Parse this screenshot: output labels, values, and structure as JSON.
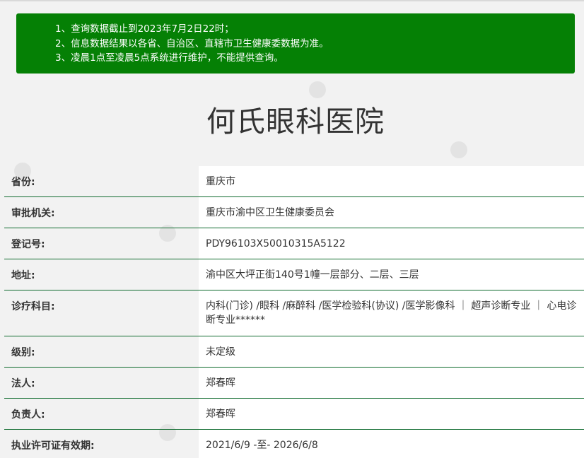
{
  "notice": {
    "lines": [
      "1、查询数据截止到2023年7月2日22时；",
      "2、信息数据结果以各省、自治区、直辖市卫生健康委数据为准。",
      "3、凌晨1点至凌晨5点系统进行维护，不能提供查询。"
    ],
    "background_color": "#058005"
  },
  "page_title": "何氏眼科医院",
  "rows": [
    {
      "label": "省份:",
      "value": "重庆市"
    },
    {
      "label": "审批机关:",
      "value": "重庆市渝中区卫生健康委员会"
    },
    {
      "label": "登记号:",
      "value": "PDY96103X50010315A5122"
    },
    {
      "label": "地址:",
      "value": "渝中区大坪正街140号1幢一层部分、二层、三层"
    },
    {
      "label": "诊疗科目:",
      "value": "内科(门诊) /眼科 /麻醉科 /医学检验科(协议) /医学影像科 ｜ 超声诊断专业 ｜ 心电诊断专业******"
    },
    {
      "label": "级别:",
      "value": "未定级"
    },
    {
      "label": "法人:",
      "value": "郑春晖"
    },
    {
      "label": "负责人:",
      "value": "郑春晖"
    },
    {
      "label": "执业许可证有效期:",
      "value": "2021/6/9 -至- 2026/6/8"
    }
  ],
  "colors": {
    "row_divider": "#0f6b2e",
    "page_background": "#f2f2f2"
  }
}
